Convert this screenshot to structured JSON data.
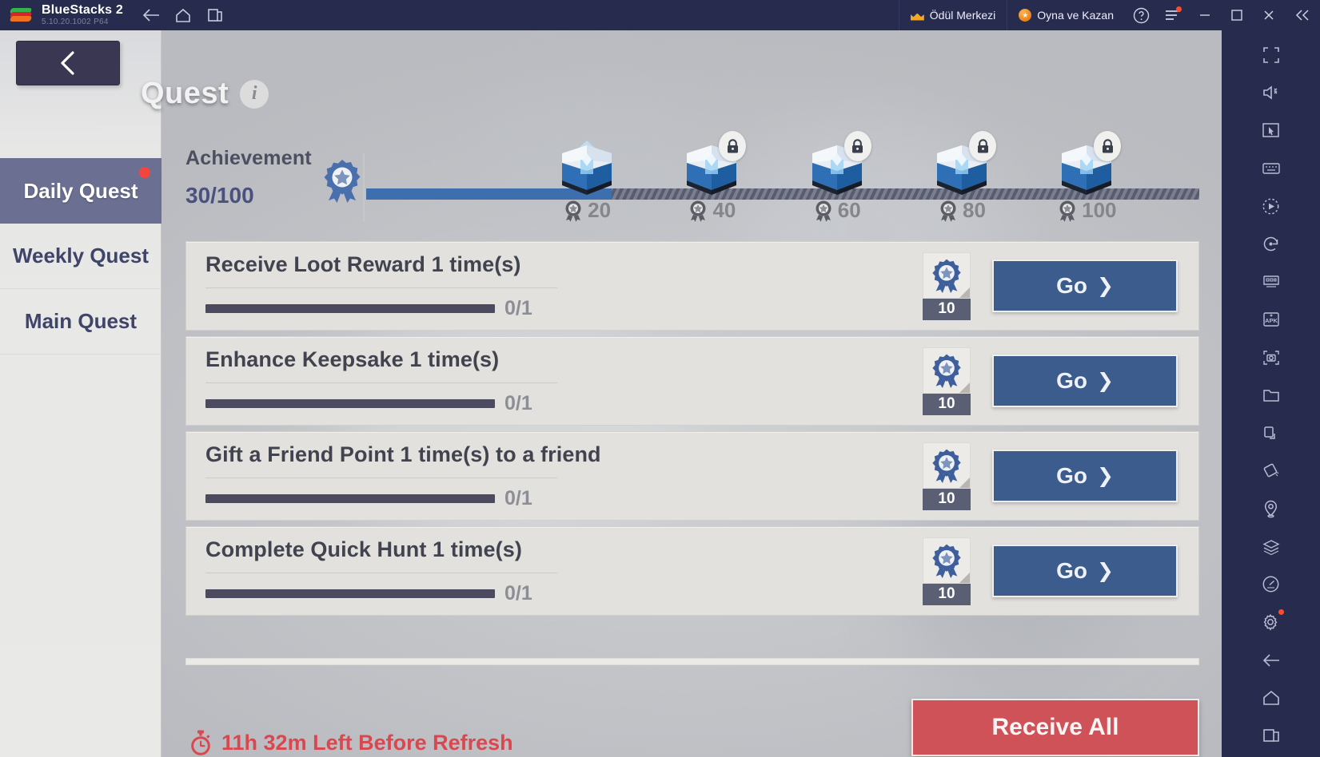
{
  "titlebar": {
    "app_name": "BlueStacks 2",
    "version": "5.10.20.1002  P64",
    "nav_icons": [
      "back-icon",
      "home-icon",
      "multi-instance-icon"
    ],
    "reward_center_label": "Ödül Merkezi",
    "play_and_earn_label": "Oyna ve Kazan",
    "help_icon": "help-icon",
    "menu_icon": "hamburger-menu-icon",
    "minimize_icon": "minimize-icon",
    "maximize_icon": "maximize-icon",
    "close_icon": "close-icon",
    "collapse_icon": "double-chevron-left-icon"
  },
  "game": {
    "back_button_icon": "chevron-left-icon",
    "page_title": "Quest",
    "info_icon": "info-icon",
    "sidebar": {
      "items": [
        {
          "label": "Daily Quest",
          "active": true,
          "badge": true
        },
        {
          "label": "Weekly Quest",
          "active": false,
          "badge": false
        },
        {
          "label": "Main Quest",
          "active": false,
          "badge": false
        }
      ]
    },
    "achievement": {
      "label": "Achievement",
      "count_text": "30/100",
      "current": 30,
      "max": 100,
      "ribbon_icon": "achievement-ribbon-icon",
      "milestones": [
        {
          "value": "20",
          "at": 20,
          "locked": false
        },
        {
          "value": "40",
          "at": 40,
          "locked": true
        },
        {
          "value": "60",
          "at": 60,
          "locked": true
        },
        {
          "value": "80",
          "at": 80,
          "locked": true
        },
        {
          "value": "100",
          "at": 100,
          "locked": true
        }
      ]
    },
    "quests": [
      {
        "title": "Receive Loot Reward 1 time(s)",
        "progress_text": "0/1",
        "progress_pct": 0,
        "reward_qty": "10",
        "action_label": "Go"
      },
      {
        "title": "Enhance Keepsake 1 time(s)",
        "progress_text": "0/1",
        "progress_pct": 0,
        "reward_qty": "10",
        "action_label": "Go"
      },
      {
        "title": "Gift a Friend Point 1 time(s) to a friend",
        "progress_text": "0/1",
        "progress_pct": 0,
        "reward_qty": "10",
        "action_label": "Go"
      },
      {
        "title": "Complete Quick Hunt 1 time(s)",
        "progress_text": "0/1",
        "progress_pct": 0,
        "reward_qty": "10",
        "action_label": "Go"
      }
    ],
    "footer": {
      "timer_icon": "stopwatch-icon",
      "timer_text": "11h 32m Left Before Refresh",
      "receive_all_label": "Receive All"
    }
  },
  "dock": {
    "icons": [
      "fullscreen-icon",
      "mute-icon",
      "cursor-pointer-icon",
      "keyboard-controls-icon",
      "macro-play-icon",
      "rotate-icon",
      "multi-instance-manager-icon",
      "install-apk-icon",
      "screenshot-icon",
      "media-folder-icon",
      "shake-icon",
      "tilt-icon",
      "location-icon",
      "layers-icon",
      "performance-icon"
    ],
    "bottom_icons": [
      "settings-icon",
      "back-icon",
      "home-icon",
      "recents-icon"
    ]
  },
  "colors": {
    "titlebar_bg": "#272b4d",
    "accent_blue": "#3d6fae",
    "go_button": "#3b5c8c",
    "receive_all": "#cf5259",
    "timer_red": "#d9484f",
    "sidebar_active": "#6b7093",
    "badge_red": "#f2453d"
  }
}
